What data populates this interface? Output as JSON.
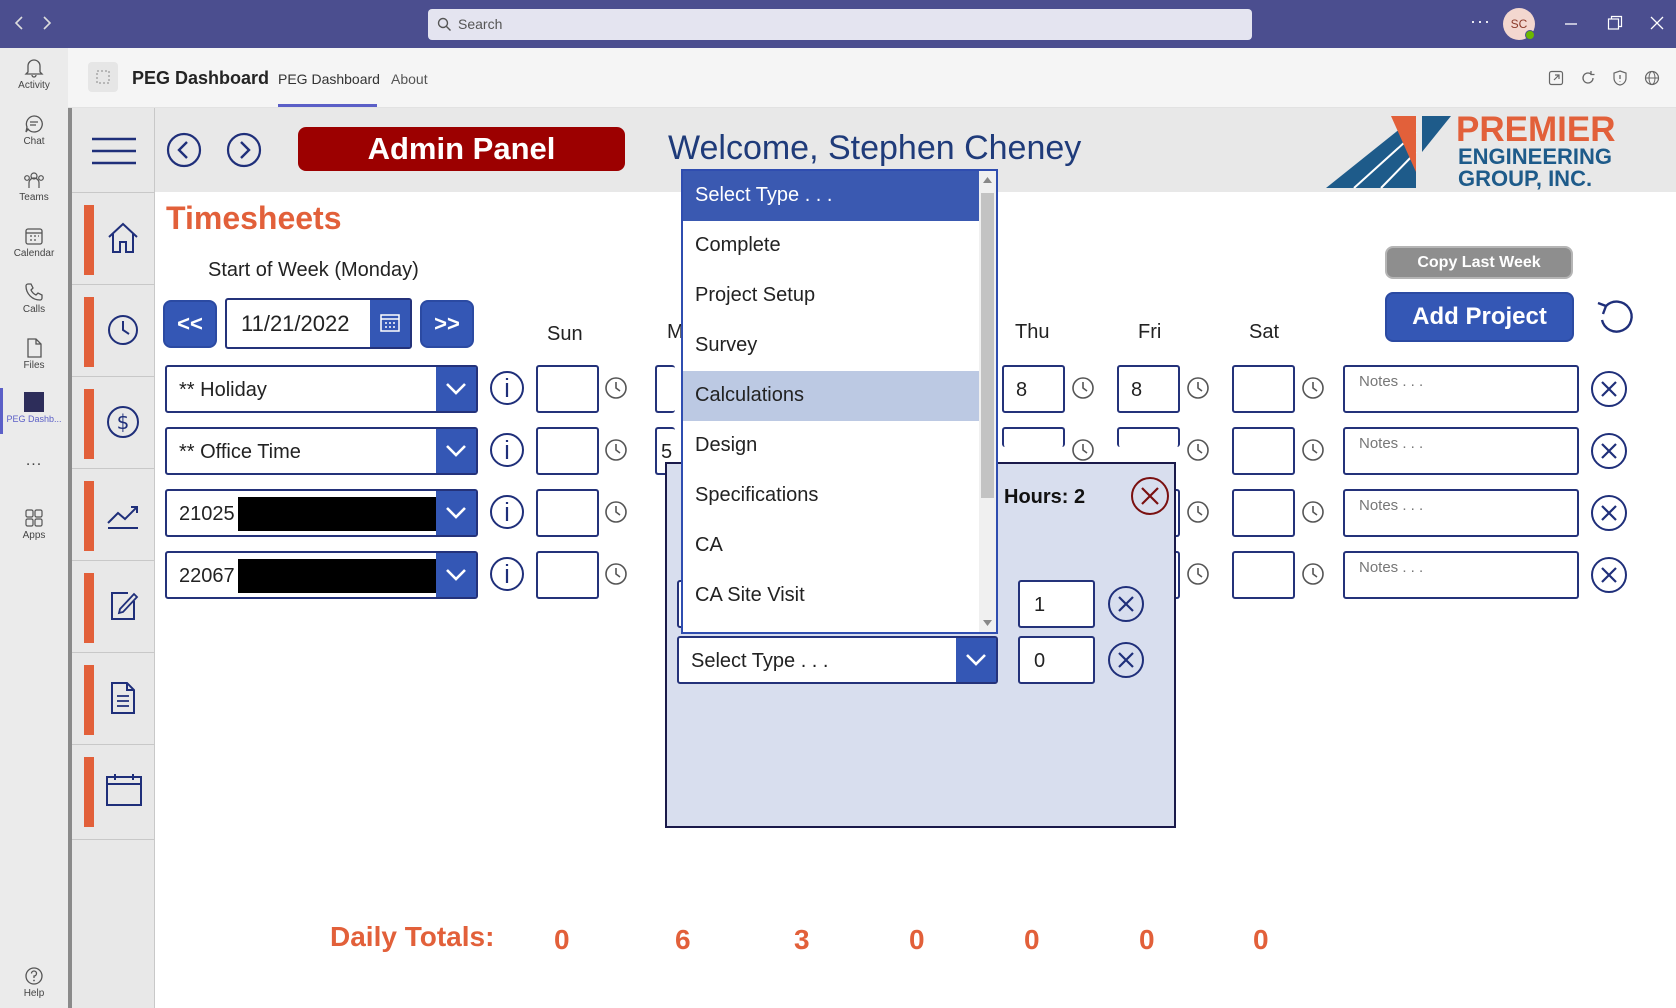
{
  "teams": {
    "search_placeholder": "Search",
    "avatar_initials": "SC",
    "rail": [
      {
        "label": "Activity",
        "icon": "bell-icon"
      },
      {
        "label": "Chat",
        "icon": "chat-icon"
      },
      {
        "label": "Teams",
        "icon": "teams-icon"
      },
      {
        "label": "Calendar",
        "icon": "calendar-icon"
      },
      {
        "label": "Calls",
        "icon": "phone-icon"
      },
      {
        "label": "Files",
        "icon": "file-icon"
      },
      {
        "label": "PEG Dashb...",
        "icon": "app-icon"
      },
      {
        "label": "Apps",
        "icon": "apps-icon"
      },
      {
        "label": "Help",
        "icon": "help-icon"
      }
    ],
    "more": "..."
  },
  "app_header": {
    "title": "PEG Dashboard",
    "tabs": [
      {
        "label": "PEG Dashboard",
        "active": true
      },
      {
        "label": "About",
        "active": false
      }
    ]
  },
  "app": {
    "admin_button": "Admin Panel",
    "welcome": "Welcome, Stephen Cheney",
    "logo": {
      "line1": "PREMIER",
      "line2": "ENGINEERING",
      "line3": "GROUP, INC."
    },
    "section_title": "Timesheets",
    "week_label": "Start of Week (Monday)",
    "prev_week": "<<",
    "next_week": ">>",
    "week_date": "11/21/2022",
    "copy_last_week": "Copy Last Week",
    "add_project": "Add Project",
    "days": [
      "Sun",
      "M",
      "Thu",
      "Fri",
      "Sat"
    ],
    "rows": [
      {
        "project": "** Holiday",
        "sun": "",
        "mon": "",
        "thu": "8",
        "fri": "8",
        "sat": "",
        "notes_placeholder": "Notes . . ."
      },
      {
        "project": "** Office Time",
        "sun": "",
        "mon": "5",
        "thu": "",
        "fri": "",
        "sat": "",
        "notes_placeholder": "Notes . . ."
      },
      {
        "project": "21025",
        "sun": "",
        "mon": "",
        "thu": "",
        "fri": "",
        "sat": "",
        "notes_placeholder": "Notes . . ."
      },
      {
        "project": "22067",
        "sun": "",
        "mon": "",
        "thu": "",
        "fri": "",
        "sat": "",
        "notes_placeholder": "Notes . . ."
      }
    ],
    "totals_label": "Daily Totals:",
    "totals": [
      "0",
      "6",
      "3",
      "0",
      "0",
      "0",
      "0"
    ]
  },
  "popup": {
    "hours_label": "Hours: 2",
    "lines": [
      {
        "hours": "1"
      },
      {
        "type": "Select Type . . .",
        "hours": "0"
      }
    ]
  },
  "dropdown": {
    "selected": "Select Type . . .",
    "hovered": "Calculations",
    "options": [
      "Select Type . . .",
      "Complete",
      "Project Setup",
      "Survey",
      "Calculations",
      "Design",
      "Specifications",
      "CA",
      "CA Site Visit"
    ]
  },
  "colors": {
    "teams_purple": "#4b4e8f",
    "navy": "#1f2f7a",
    "accent_orange": "#e2603a",
    "admin_red": "#9c0000",
    "button_blue": "#3457b5",
    "dropdown_selected": "#3a59b1",
    "dropdown_hover": "#bcc9e3"
  }
}
